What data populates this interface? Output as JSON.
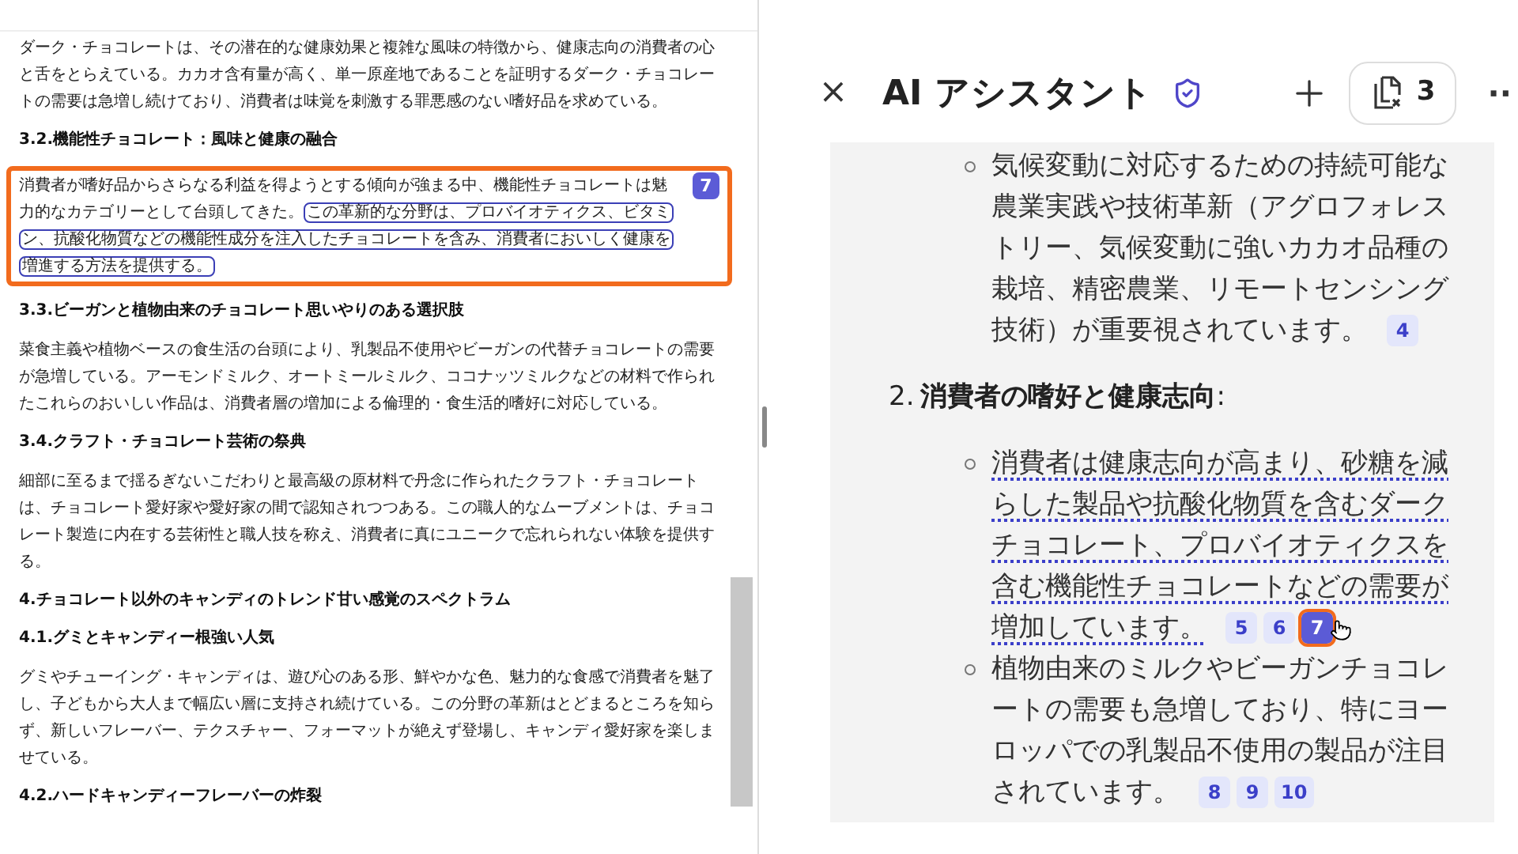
{
  "document": {
    "blocks": [
      {
        "kind": "paragraph",
        "text": "ダーク・チョコレートは、その潜在的な健康効果と複雑な風味の特徴から、健康志向の消費者の心と舌をとらえている。カカオ含有量が高く、単一原産地であることを証明するダーク・チョコレートの需要は急増し続けており、消費者は味覚を刺激する罪悪感のない嗜好品を求めている。"
      },
      {
        "kind": "heading",
        "text": "3.2.機能性チョコレート：風味と健康の融合"
      },
      {
        "kind": "paragraph",
        "text": "消費者が嗜好品からさらなる利益を得ようとする傾向が強まる中、機能性チョコレートは魅力的なカテゴリーとして台頭してきた。",
        "highlight": "この革新的な分野は、プロバイオティクス、ビタミン、抗酸化物質などの機能性成分を注入したチョコレートを含み、消費者においしく健康を増進する方法を提供する。",
        "focused": true,
        "citation": {
          "label": "7",
          "selected": true
        }
      },
      {
        "kind": "heading",
        "text": "3.3.ビーガンと植物由来のチョコレート思いやりのある選択肢"
      },
      {
        "kind": "paragraph",
        "text": "菜食主義や植物ベースの食生活の台頭により、乳製品不使用やビーガンの代替チョコレートの需要が急増している。アーモンドミルク、オートミールミルク、ココナッツミルクなどの材料で作られたこれらのおいしい作品は、消費者層の増加による倫理的・食生活的嗜好に対応している。"
      },
      {
        "kind": "heading",
        "text": "3.4.クラフト・チョコレート芸術の祭典"
      },
      {
        "kind": "paragraph",
        "text": "細部に至るまで揺るぎないこだわりと最高級の原材料で丹念に作られたクラフト・チョコレートは、チョコレート愛好家や愛好家の間で認知されつつある。この職人的なムーブメントは、チョコレート製造に内在する芸術性と職人技を称え、消費者に真にユニークで忘れられない体験を提供する。"
      },
      {
        "kind": "heading",
        "text": "4.チョコレート以外のキャンディのトレンド甘い感覚のスペクトラム"
      },
      {
        "kind": "heading",
        "text": "4.1.グミとキャンディー根強い人気"
      },
      {
        "kind": "paragraph",
        "text": "グミやチューイング・キャンディは、遊び心のある形、鮮やかな色、魅力的な食感で消費者を魅了し、子どもから大人まで幅広い層に支持され続けている。この分野の革新はとどまるところを知らず、新しいフレーバー、テクスチャー、フォーマットが絶えず登場し、キャンディ愛好家を楽しませている。"
      },
      {
        "kind": "heading",
        "text": "4.2.ハードキャンディーフレーバーの炸裂"
      }
    ]
  },
  "assistant": {
    "close": "×",
    "title": "AI アシスタント",
    "sources_count": "3",
    "more": "··",
    "items": [
      {
        "kind": "bullet",
        "text": "気候変動に対応するための持続可能な農業実践や技術革新（アグロフォレストリー、気候変動に強いカカオ品種の栽培、精密農業、リモートセンシング技術）が重要視されています。",
        "underlined": false,
        "citations": [
          {
            "label": "4",
            "selected": false
          }
        ]
      },
      {
        "kind": "numbered",
        "number": "2.",
        "text": "消費者の嗜好と健康志向",
        "suffix": ":"
      },
      {
        "kind": "bullet",
        "text": "消費者は健康志向が高まり、砂糖を減らした製品や抗酸化物質を含むダークチョコレート、プロバイオティクスを含む機能性チョコレートなどの需要が増加しています。",
        "underlined": true,
        "citations": [
          {
            "label": "5",
            "selected": false
          },
          {
            "label": "6",
            "selected": false
          },
          {
            "label": "7",
            "selected": true
          }
        ]
      },
      {
        "kind": "bullet",
        "text": "植物由来のミルクやビーガンチョコレートの需要も急増しており、特にヨーロッパでの乳製品不使用の製品が注目されています。",
        "underlined": false,
        "citations": [
          {
            "label": "8",
            "selected": false
          },
          {
            "label": "9",
            "selected": false
          },
          {
            "label": "10",
            "selected": false
          }
        ]
      }
    ]
  }
}
